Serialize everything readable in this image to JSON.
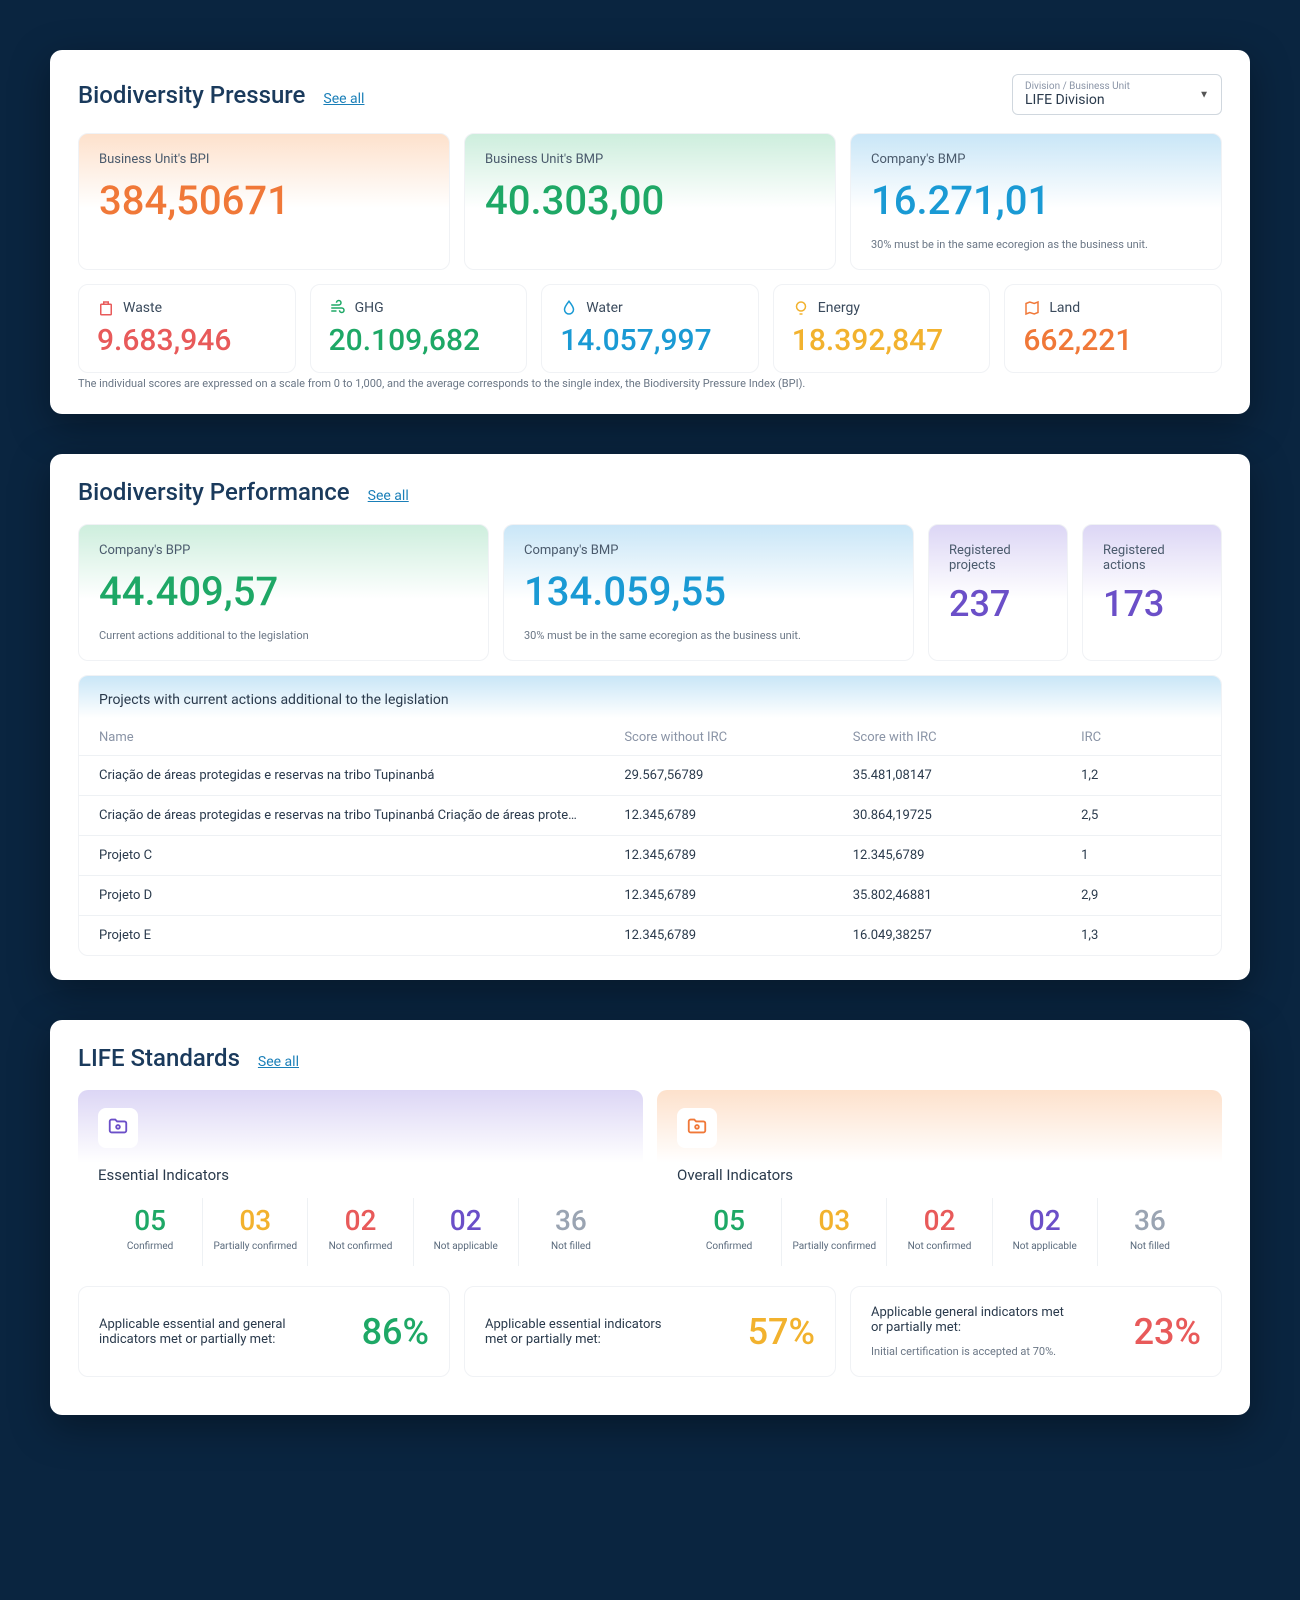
{
  "pressure": {
    "title": "Biodiversity Pressure",
    "see_all": "See all",
    "select": {
      "label": "Division / Business Unit",
      "value": "LIFE Division"
    },
    "cards": {
      "bpi": {
        "label": "Business Unit's BPI",
        "value": "384,50671"
      },
      "bmp": {
        "label": "Business Unit's BMP",
        "value": "40.303,00"
      },
      "cbmp": {
        "label": "Company's BMP",
        "value": "16.271,01",
        "note": "30% must be in the same ecoregion as the business unit."
      }
    },
    "metrics": {
      "waste": {
        "label": "Waste",
        "value": "9.683,946"
      },
      "ghg": {
        "label": "GHG",
        "value": "20.109,682"
      },
      "water": {
        "label": "Water",
        "value": "14.057,997"
      },
      "energy": {
        "label": "Energy",
        "value": "18.392,847"
      },
      "land": {
        "label": "Land",
        "value": "662,221"
      }
    },
    "footnote": "The individual scores are expressed on a scale from 0 to 1,000, and the average corresponds to the single index, the Biodiversity Pressure Index (BPI)."
  },
  "performance": {
    "title": "Biodiversity Performance",
    "see_all": "See all",
    "cards": {
      "bpp": {
        "label": "Company's BPP",
        "value": "44.409,57",
        "note": "Current actions additional to the legislation"
      },
      "bmp": {
        "label": "Company's BMP",
        "value": "134.059,55",
        "note": "30% must be in the same ecoregion as the business unit."
      },
      "projects": {
        "label": "Registered projects",
        "value": "237"
      },
      "actions": {
        "label": "Registered actions",
        "value": "173"
      }
    },
    "table": {
      "title": "Projects with current actions additional to the legislation",
      "cols": {
        "name": "Name",
        "sw": "Score without IRC",
        "swi": "Score with IRC",
        "irc": "IRC"
      },
      "rows": [
        {
          "name": "Criação de áreas protegidas e reservas na tribo Tupinanbá",
          "sw": "29.567,56789",
          "swi": "35.481,08147",
          "irc": "1,2"
        },
        {
          "name": "Criação de áreas protegidas e reservas na tribo Tupinanbá Criação de áreas protegidas e res...",
          "sw": "12.345,6789",
          "swi": "30.864,19725",
          "irc": "2,5"
        },
        {
          "name": "Projeto C",
          "sw": "12.345,6789",
          "swi": "12.345,6789",
          "irc": "1"
        },
        {
          "name": "Projeto D",
          "sw": "12.345,6789",
          "swi": "35.802,46881",
          "irc": "2,9"
        },
        {
          "name": "Projeto E",
          "sw": "12.345,6789",
          "swi": "16.049,38257",
          "irc": "1,3"
        }
      ]
    }
  },
  "standards": {
    "title": "LIFE Standards",
    "see_all": "See all",
    "essential": {
      "title": "Essential Indicators",
      "stats": [
        {
          "num": "05",
          "label": "Confirmed",
          "color": "c-green"
        },
        {
          "num": "03",
          "label": "Partially confirmed",
          "color": "c-yellow"
        },
        {
          "num": "02",
          "label": "Not confirmed",
          "color": "c-red"
        },
        {
          "num": "02",
          "label": "Not applicable",
          "color": "c-purple"
        },
        {
          "num": "36",
          "label": "Not filled",
          "color": "c-gray"
        }
      ]
    },
    "overall": {
      "title": "Overall Indicators",
      "stats": [
        {
          "num": "05",
          "label": "Confirmed",
          "color": "c-green"
        },
        {
          "num": "03",
          "label": "Partially confirmed",
          "color": "c-yellow"
        },
        {
          "num": "02",
          "label": "Not confirmed",
          "color": "c-red"
        },
        {
          "num": "02",
          "label": "Not applicable",
          "color": "c-purple"
        },
        {
          "num": "36",
          "label": "Not filled",
          "color": "c-gray"
        }
      ]
    },
    "pcts": [
      {
        "text": "Applicable essential and general indicators met or partially met:",
        "value": "86%",
        "color": "c-green",
        "sub": ""
      },
      {
        "text": "Applicable essential indicators met or partially met:",
        "value": "57%",
        "color": "c-yellow",
        "sub": ""
      },
      {
        "text": "Applicable general indicators met or partially met:",
        "value": "23%",
        "color": "c-red",
        "sub": "Initial certification is accepted at 70%."
      }
    ]
  }
}
